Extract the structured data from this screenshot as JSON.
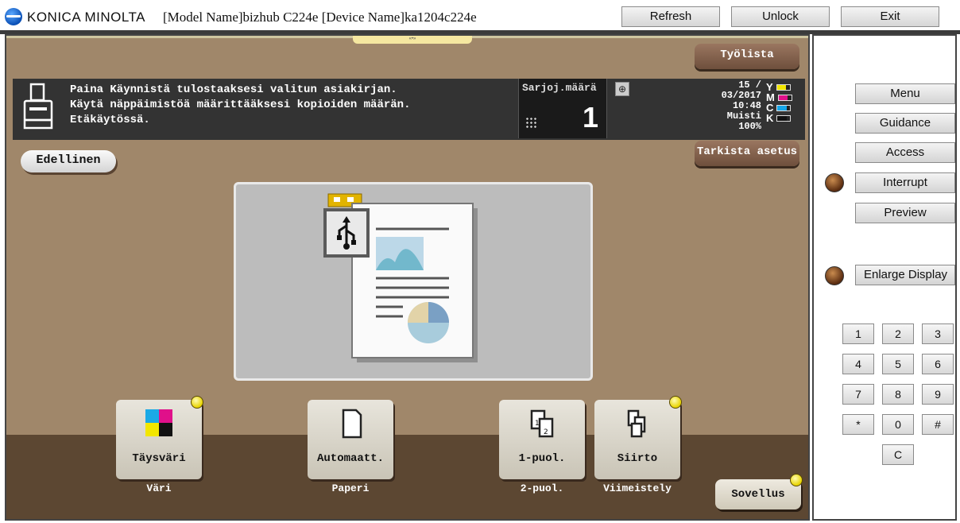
{
  "header": {
    "brand": "KONICA MINOLTA",
    "model_text": "[Model Name]bizhub C224e [Device Name]ka1204c224e",
    "buttons": {
      "refresh": "Refresh",
      "unlock": "Unlock",
      "exit": "Exit"
    }
  },
  "main": {
    "job_list_tab": "Työlista",
    "check_settings_tab": "Tarkista asetus",
    "message_lines": [
      "Paina Käynnistä tulostaaksesi valitun asiakirjan.",
      "Käytä näppäimistöä määrittääksesi kopioiden määrän.",
      "Etäkäytössä."
    ],
    "copy_count_label": "Sarjoj.määrä",
    "copy_count": "1",
    "status": {
      "date": "15 / 03/2017",
      "time": "10:48",
      "memory_label": "Muisti",
      "memory_value": "100%",
      "toner": [
        "Y",
        "M",
        "C",
        "K"
      ],
      "toner_colors": [
        "#f2e600",
        "#e0108a",
        "#16a6e8",
        "#111111"
      ]
    },
    "previous_button": "Edellinen",
    "functions": [
      {
        "label": "Täysväri",
        "sub": "Väri"
      },
      {
        "label": "Automaatt.",
        "sub": "Paperi"
      },
      {
        "label": "1-puol.",
        "sub": "2-puol."
      },
      {
        "label": "Siirto",
        "sub": "Viimeistely"
      }
    ],
    "application_button": "Sovellus",
    "drag_handle_glyph": "«•»"
  },
  "side": {
    "buttons": [
      "Menu",
      "Guidance",
      "Access",
      "Interrupt",
      "Preview",
      "Enlarge Display"
    ],
    "keypad": [
      "1",
      "2",
      "3",
      "4",
      "5",
      "6",
      "7",
      "8",
      "9",
      "*",
      "0",
      "#"
    ],
    "clear_key": "C"
  }
}
